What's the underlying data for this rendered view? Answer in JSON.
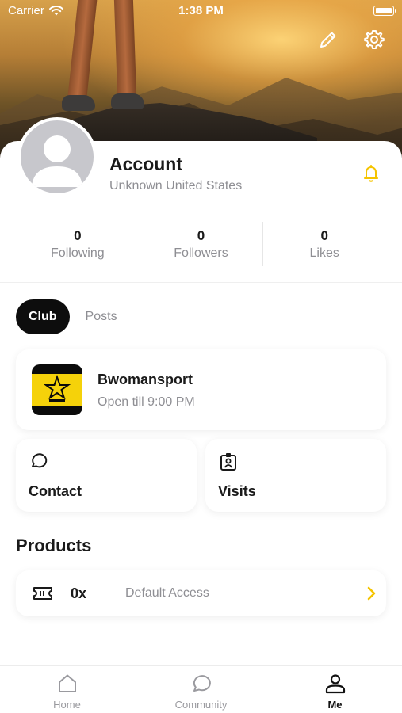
{
  "status_bar": {
    "carrier": "Carrier",
    "time": "1:38 PM"
  },
  "profile": {
    "name": "Account",
    "location": "Unknown United States",
    "stats": [
      {
        "value": "0",
        "label": "Following"
      },
      {
        "value": "0",
        "label": "Followers"
      },
      {
        "value": "0",
        "label": "Likes"
      }
    ]
  },
  "tabs": [
    {
      "label": "Club",
      "active": true
    },
    {
      "label": "Posts",
      "active": false
    }
  ],
  "club": {
    "name": "Bwomansport",
    "hours": "Open till 9:00 PM"
  },
  "quick_actions": {
    "contact": "Contact",
    "visits": "Visits"
  },
  "products": {
    "title": "Products",
    "items": [
      {
        "count": "0x",
        "name": "Default Access"
      }
    ]
  },
  "bottom_nav": [
    {
      "label": "Home",
      "icon": "home-icon",
      "active": false
    },
    {
      "label": "Community",
      "icon": "chat-icon",
      "active": false
    },
    {
      "label": "Me",
      "icon": "person-icon",
      "active": true
    }
  ],
  "colors": {
    "accent": "#F5C400",
    "tab_active_bg": "#0D0D0D",
    "muted_text": "#8E8E93"
  }
}
